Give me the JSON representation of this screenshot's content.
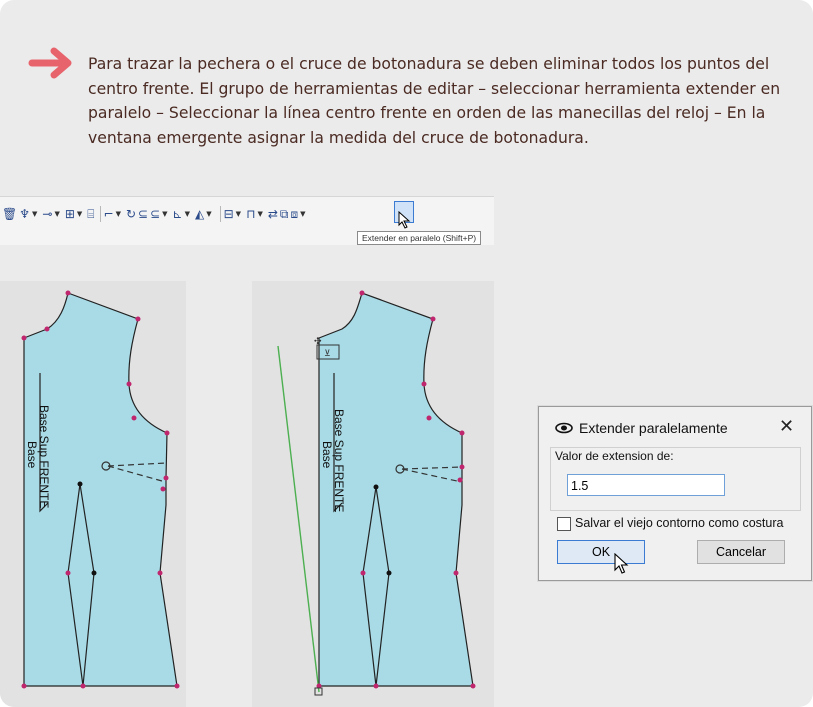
{
  "instruction": {
    "text": "Para trazar la pechera o el cruce de botonadura se deben eliminar todos los puntos del centro frente. El grupo de herramientas de editar – seleccionar herramienta extender en paralelo – Seleccionar la línea centro frente en orden de las manecillas del reloj – En la ventana emergente asignar la medida del cruce de botonadura."
  },
  "toolbar": {
    "tooltip": "Extender en paralelo (Shift+P)"
  },
  "patterns": {
    "label_line1": "Base Sup FRENTE",
    "label_line2": "Base"
  },
  "dialog": {
    "title": "Extender paralelamente",
    "close": "✕",
    "field_label": "Valor de extension de:",
    "field_value": "1.5",
    "checkbox_label": "Salvar el viejo contorno como costura",
    "ok_label": "OK",
    "cancel_label": "Cancelar"
  },
  "colors": {
    "card_background": "#ebebeb",
    "instruction_text": "#4a2a22",
    "arrow": "#e8646c",
    "pattern_fill": "#a9dbe6",
    "point": "#c0266e",
    "guide_line": "#4caf50"
  }
}
